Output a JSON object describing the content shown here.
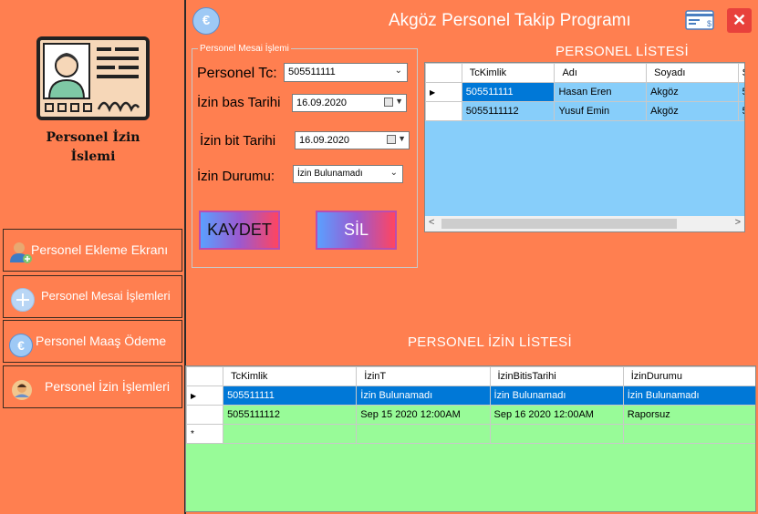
{
  "window": {
    "title": "Akgöz Personel Takip Programı"
  },
  "sidebar": {
    "title_line1": "Personel İzin",
    "title_line2": "İslemi",
    "items": [
      {
        "label": "Personel Ekleme Ekranı"
      },
      {
        "label": "Personel Mesai İşlemleri"
      },
      {
        "label": "Personel Maaş Ödeme"
      },
      {
        "label": "Personel İzin İşlemleri"
      }
    ]
  },
  "form": {
    "group_title": "Personel Mesai İşlemi",
    "tc_label": "Personel Tc:",
    "tc_value": "505511111",
    "start_label": "İzin bas Tarihi",
    "start_value": "16.09.2020",
    "end_label": "İzin bit Tarihi",
    "end_value": "16.09.2020",
    "status_label": "İzin Durumu:",
    "status_value": "İzin Bulunamadı",
    "save_label": "KAYDET",
    "delete_label": "SİL"
  },
  "personnel_list": {
    "title": "PERSONEL LİSTESİ",
    "columns": [
      "TcKimlik",
      "Adı",
      "Soyadı",
      "S"
    ],
    "rows": [
      [
        "505511111",
        "Hasan Eren",
        "Akgöz",
        "5"
      ],
      [
        "5055111112",
        "Yusuf Emin",
        "Akgöz",
        "5"
      ]
    ]
  },
  "leave_list": {
    "title": "PERSONEL İZİN LİSTESİ",
    "columns": [
      "TcKimlik",
      "İzinT",
      "İzinBitisTarihi",
      "İzinDurumu"
    ],
    "rows": [
      [
        "505511111",
        "İzin Bulunamadı",
        "İzin Bulunamadı",
        "İzin Bulunamadı"
      ],
      [
        "5055111112",
        "Sep 15 2020 12:00AM",
        "Sep 16 2020 12:00AM",
        "Raporsuz"
      ]
    ],
    "new_row_marker": "*"
  },
  "icons": {
    "euro": "€",
    "close": "✕",
    "row_pointer": "▶",
    "scroll_left": "<",
    "scroll_right": ">"
  },
  "colors": {
    "background": "#FF7F50",
    "grid_empty_personnel": "#87CEFA",
    "grid_empty_leave": "#98FB98",
    "selection": "#0078D7",
    "close_button": "#E8413C"
  }
}
